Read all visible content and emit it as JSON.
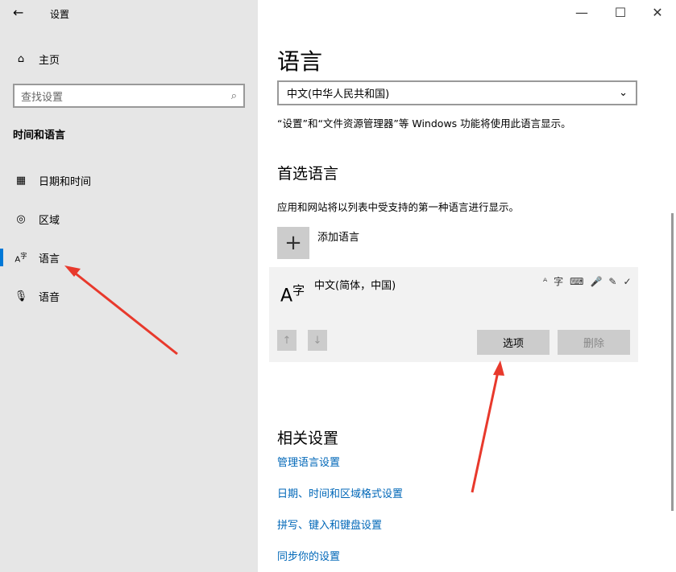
{
  "window": {
    "title": "设置",
    "back_icon": "←",
    "minimize": "—",
    "maximize": "☐",
    "close": "✕"
  },
  "sidebar": {
    "home": "主页",
    "search_placeholder": "查找设置",
    "section": "时间和语言",
    "items": [
      {
        "label": "日期和时间",
        "icon": "📅"
      },
      {
        "label": "区域",
        "icon": "◎"
      },
      {
        "label": "语言",
        "icon": "A字"
      },
      {
        "label": "语音",
        "icon": "🎤"
      }
    ]
  },
  "main": {
    "title": "语言",
    "display_lang": "中文(中华人民共和国)",
    "display_note": "“设置”和“文件资源管理器”等 Windows 功能将使用此语言显示。",
    "preferred_title": "首选语言",
    "preferred_note": "应用和网站将以列表中受支持的第一种语言进行显示。",
    "add_lang": "添加语言",
    "lang_item": {
      "name": "中文(简体，中国)",
      "options": "选项",
      "remove": "删除"
    },
    "related_title": "相关设置",
    "links": [
      "管理语言设置",
      "日期、时间和区域格式设置",
      "拼写、键入和键盘设置",
      "同步你的设置"
    ]
  },
  "colors": {
    "accent": "#0078d7",
    "arrow": "#e8392c"
  }
}
